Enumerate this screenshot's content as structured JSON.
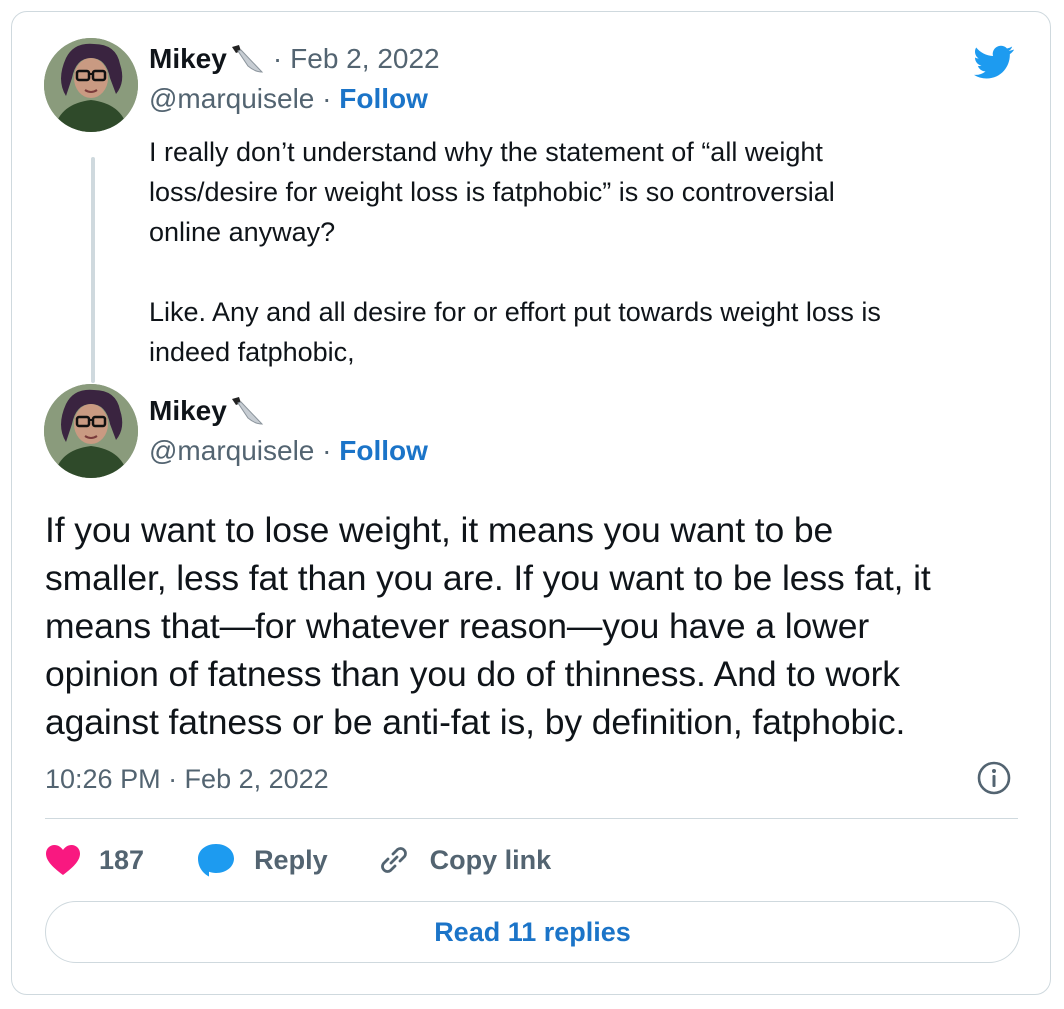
{
  "reply_tweet": {
    "author_name": "Mikey",
    "author_emoji": "knife-icon",
    "separator": "·",
    "date": "Feb 2, 2022",
    "handle": "@marquisele",
    "follow_separator": "·",
    "follow_label": "Follow",
    "text_lines": [
      "I really don’t understand why the statement of “all weight",
      "loss/desire for weight loss is fatphobic” is so controversial",
      "online anyway?"
    ],
    "text_lines_2": [
      "Like. Any and all desire for or effort put towards weight loss is",
      "indeed fatphobic,"
    ]
  },
  "main_tweet": {
    "author_name": "Mikey",
    "author_emoji": "knife-icon",
    "handle": "@marquisele",
    "follow_separator": "·",
    "follow_label": "Follow",
    "text_lines": [
      "If you want to lose weight, it means you want to be",
      "smaller, less fat than you are. If you want to be less fat, it",
      "means that—for whatever reason—you have a lower",
      "opinion of fatness than you do of thinness. And to work",
      "against fatness or be anti-fat is, by definition, fatphobic."
    ],
    "timestamp": "10:26 PM · Feb 2, 2022"
  },
  "actions": {
    "like_count": "187",
    "reply_label": "Reply",
    "copy_link_label": "Copy link"
  },
  "read_replies_label": "Read 11 replies",
  "colors": {
    "accent": "#1b74c8",
    "twitter_blue": "#1d9bf0",
    "like_pink": "#f91880",
    "muted": "#536471",
    "border": "#cfd9de"
  }
}
